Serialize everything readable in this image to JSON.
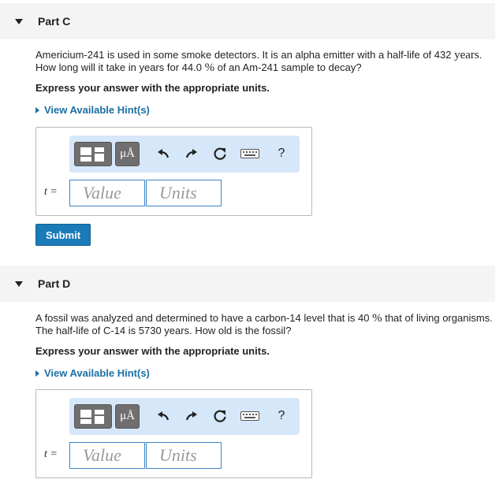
{
  "partC": {
    "title": "Part C",
    "question_a": "Americium-241 is used in some smoke detectors. It is an alpha emitter with a half-life of 432 ",
    "question_years": "years",
    "question_b": ".",
    "question_line2_a": "How long will it take in years for 44.0 ",
    "question_percent": "%",
    "question_line2_b": " of an Am-241 sample to decay?",
    "express": "Express your answer with the appropriate units.",
    "hint": "View Available Hint(s)",
    "variable": "t =",
    "value_placeholder": "Value",
    "units_placeholder": "Units",
    "submit": "Submit"
  },
  "partD": {
    "title": "Part D",
    "question_a": "A fossil was analyzed and determined to have a carbon-14 level that is 40 ",
    "question_percent": "%",
    "question_b": " that of living organisms.",
    "question_line2": "The half-life of C-14 is 5730 years. How old is the fossil?",
    "express": "Express your answer with the appropriate units.",
    "hint": "View Available Hint(s)",
    "variable": "t =",
    "value_placeholder": "Value",
    "units_placeholder": "Units"
  },
  "toolbar": {
    "units_symbol": "μÅ",
    "help": "?",
    "icons": [
      "templates-icon",
      "units-icon",
      "undo-icon",
      "redo-icon",
      "reset-icon",
      "keyboard-icon",
      "help-icon"
    ]
  },
  "colors": {
    "accent": "#1a7bb8",
    "toolbar_bg": "#d5e7f8",
    "link": "#1a6fa3"
  }
}
